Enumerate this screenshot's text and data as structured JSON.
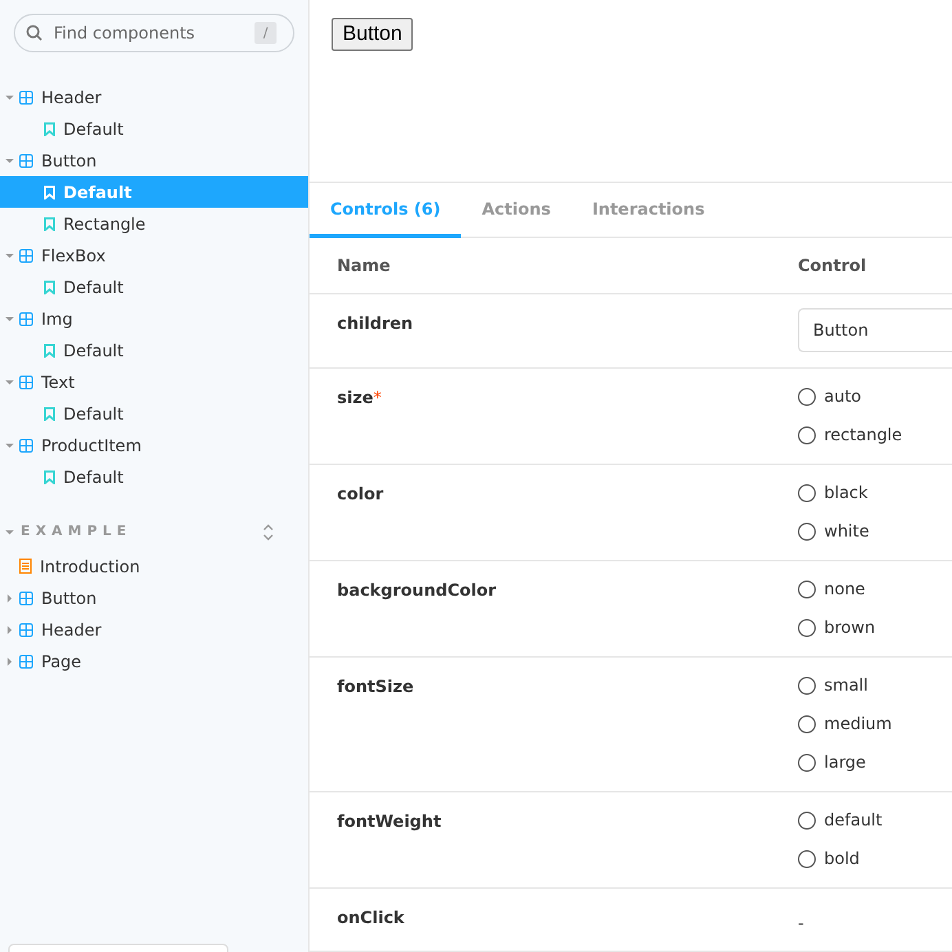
{
  "search": {
    "placeholder": "Find components",
    "shortcut": "/"
  },
  "tree": [
    {
      "kind": "component",
      "label": "Header",
      "expanded": true,
      "children": [
        {
          "label": "Default",
          "selected": false
        }
      ]
    },
    {
      "kind": "component",
      "label": "Button",
      "expanded": true,
      "children": [
        {
          "label": "Default",
          "selected": true
        },
        {
          "label": "Rectangle",
          "selected": false
        }
      ]
    },
    {
      "kind": "component",
      "label": "FlexBox",
      "expanded": true,
      "children": [
        {
          "label": "Default",
          "selected": false
        }
      ]
    },
    {
      "kind": "component",
      "label": "Img",
      "expanded": true,
      "children": [
        {
          "label": "Default",
          "selected": false
        }
      ]
    },
    {
      "kind": "component",
      "label": "Text",
      "expanded": true,
      "children": [
        {
          "label": "Default",
          "selected": false
        }
      ]
    },
    {
      "kind": "component",
      "label": "ProductItem",
      "expanded": true,
      "children": [
        {
          "label": "Default",
          "selected": false
        }
      ]
    }
  ],
  "section": {
    "title": "EXAMPLE",
    "expanded": true,
    "items": [
      {
        "kind": "docs",
        "label": "Introduction"
      },
      {
        "kind": "component",
        "label": "Button",
        "expanded": false
      },
      {
        "kind": "component",
        "label": "Header",
        "expanded": false
      },
      {
        "kind": "component",
        "label": "Page",
        "expanded": false
      }
    ]
  },
  "preview": {
    "button": "Button"
  },
  "tabs": [
    {
      "label": "Controls (6)",
      "selected": true
    },
    {
      "label": "Actions",
      "selected": false
    },
    {
      "label": "Interactions",
      "selected": false
    }
  ],
  "table": {
    "columns": [
      "Name",
      "Control"
    ],
    "rows": [
      {
        "name": "children",
        "kind": "text",
        "value": "Button"
      },
      {
        "name": "size",
        "required_mark": "*",
        "kind": "radio",
        "options": [
          {
            "label": "auto",
            "checked": false
          },
          {
            "label": "rectangle",
            "checked": false
          }
        ]
      },
      {
        "name": "color",
        "kind": "radio",
        "options": [
          {
            "label": "black",
            "checked": false
          },
          {
            "label": "white",
            "checked": false
          }
        ]
      },
      {
        "name": "backgroundColor",
        "kind": "radio",
        "options": [
          {
            "label": "none",
            "checked": false
          },
          {
            "label": "brown",
            "checked": false
          }
        ]
      },
      {
        "name": "fontSize",
        "kind": "radio",
        "options": [
          {
            "label": "small",
            "checked": false
          },
          {
            "label": "medium",
            "checked": false
          },
          {
            "label": "large",
            "checked": false
          }
        ]
      },
      {
        "name": "fontWeight",
        "kind": "radio",
        "options": [
          {
            "label": "default",
            "checked": false
          },
          {
            "label": "bold",
            "checked": false
          }
        ]
      },
      {
        "name": "onClick",
        "kind": "none",
        "value": "-"
      }
    ]
  }
}
